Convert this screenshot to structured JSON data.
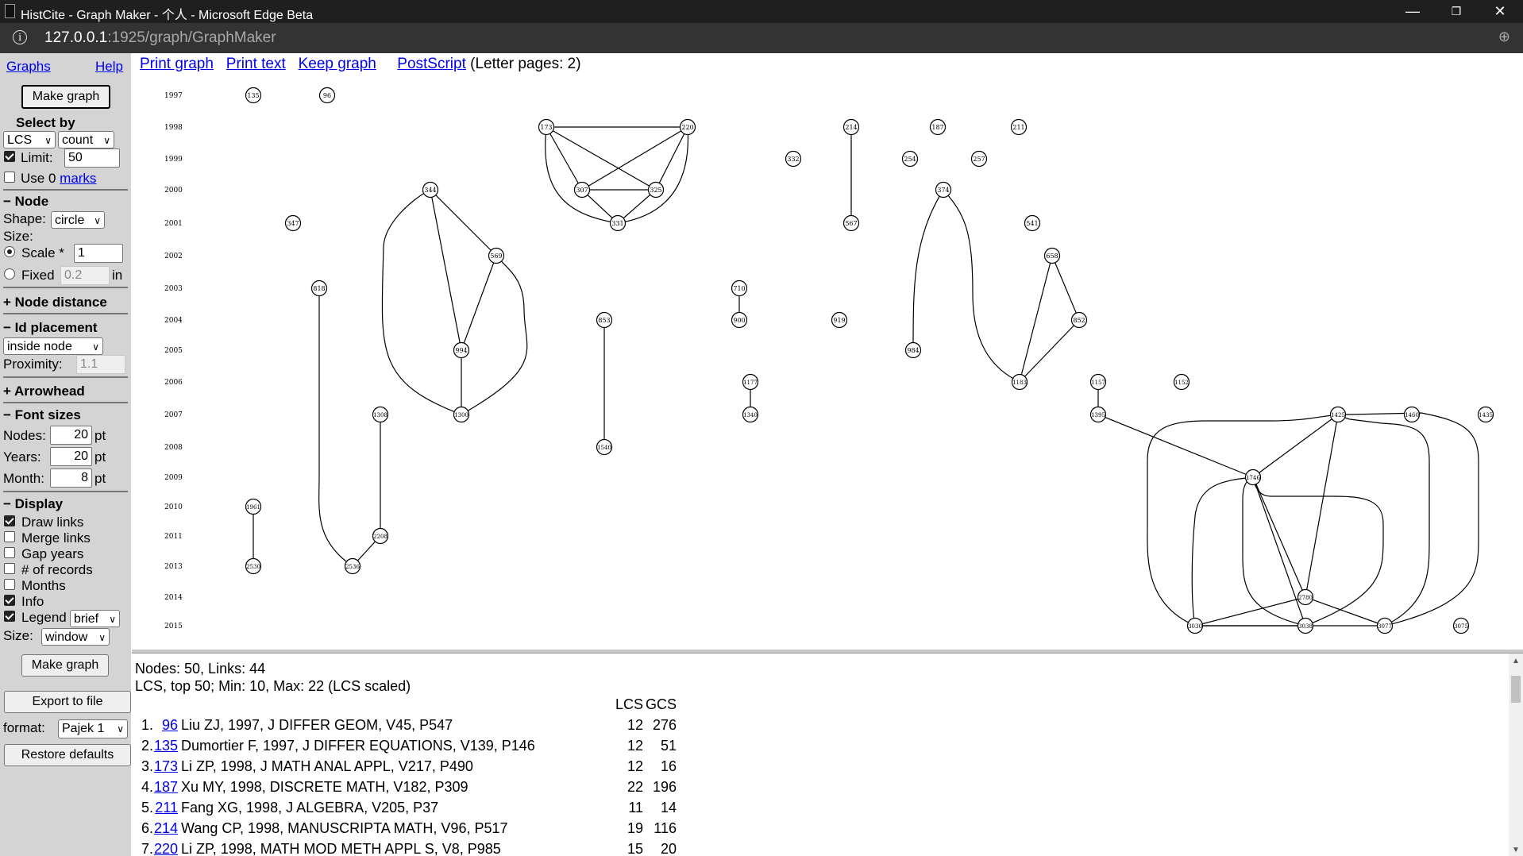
{
  "window": {
    "title": "HistCite - Graph Maker - 个人 - Microsoft Edge Beta",
    "minimize": "—",
    "maximize": "❐",
    "close": "✕"
  },
  "address": {
    "host": "127.0.0.1",
    "path": ":1925/graph/GraphMaker"
  },
  "sidebar": {
    "graphs_link": "Graphs",
    "help_link": "Help",
    "make_graph": "Make graph",
    "select_by": "Select by",
    "select_field": "LCS",
    "select_mode": "count",
    "limit_label": "Limit:",
    "limit_value": "50",
    "use_label": "Use 0",
    "marks_link": "marks",
    "node_header": "− Node",
    "shape_label": "Shape:",
    "shape_value": "circle",
    "size_label": "Size:",
    "scale_label": "Scale *",
    "scale_value": "1",
    "fixed_label": "Fixed",
    "fixed_value": "0.2",
    "fixed_unit": "in",
    "node_distance_header": "+ Node distance",
    "id_placement_header": "− Id placement",
    "id_placement_value": "inside node",
    "proximity_label": "Proximity:",
    "proximity_value": "1.1",
    "arrowhead_header": "+ Arrowhead",
    "font_sizes_header": "− Font sizes",
    "nodes_label": "Nodes:",
    "nodes_value": "20",
    "years_label": "Years:",
    "years_value": "20",
    "month_label": "Month:",
    "month_value": "8",
    "pt": "pt",
    "display_header": "− Display",
    "display_options": [
      {
        "label": "Draw links",
        "checked": true
      },
      {
        "label": "Merge links",
        "checked": false
      },
      {
        "label": "Gap years",
        "checked": false
      },
      {
        "label": "# of records",
        "checked": false
      },
      {
        "label": "Months",
        "checked": false
      },
      {
        "label": "Info",
        "checked": true
      },
      {
        "label": "Legend",
        "checked": true
      }
    ],
    "legend_value": "brief",
    "size2_label": "Size:",
    "size2_value": "window",
    "make_graph2": "Make graph",
    "export": "Export to file",
    "format_label": "format:",
    "format_value": "Pajek 1",
    "restore": "Restore defaults"
  },
  "toplinks": {
    "print_graph": "Print graph",
    "print_text": "Print text",
    "keep_graph": "Keep graph",
    "postscript": "PostScript",
    "pages": "(Letter pages: 2)"
  },
  "graph": {
    "years": [
      "1997",
      "1998",
      "1999",
      "2000",
      "2001",
      "2002",
      "2003",
      "2004",
      "2005",
      "2006",
      "2007",
      "2008",
      "2009",
      "2010",
      "2011",
      "2013",
      "2014",
      "2015"
    ],
    "nodes": [
      {
        "id": "135",
        "year": "1997"
      },
      {
        "id": "96",
        "year": "1997"
      },
      {
        "id": "173",
        "year": "1998"
      },
      {
        "id": "220",
        "year": "1998"
      },
      {
        "id": "214",
        "year": "1998"
      },
      {
        "id": "187",
        "year": "1998"
      },
      {
        "id": "211",
        "year": "1998"
      },
      {
        "id": "332",
        "year": "1999"
      },
      {
        "id": "254",
        "year": "1999"
      },
      {
        "id": "257",
        "year": "1999"
      },
      {
        "id": "344",
        "year": "2000"
      },
      {
        "id": "307",
        "year": "2000"
      },
      {
        "id": "325",
        "year": "2000"
      },
      {
        "id": "374",
        "year": "2000"
      },
      {
        "id": "347",
        "year": "2001"
      },
      {
        "id": "331",
        "year": "2001"
      },
      {
        "id": "567",
        "year": "2001"
      },
      {
        "id": "541",
        "year": "2001"
      },
      {
        "id": "569",
        "year": "2002"
      },
      {
        "id": "658",
        "year": "2002"
      },
      {
        "id": "818",
        "year": "2003"
      },
      {
        "id": "710",
        "year": "2003"
      },
      {
        "id": "853",
        "year": "2004"
      },
      {
        "id": "900",
        "year": "2004"
      },
      {
        "id": "919",
        "year": "2004"
      },
      {
        "id": "852",
        "year": "2004"
      },
      {
        "id": "994",
        "year": "2005"
      },
      {
        "id": "984",
        "year": "2005"
      },
      {
        "id": "1177",
        "year": "2006"
      },
      {
        "id": "1183",
        "year": "2006"
      },
      {
        "id": "1157",
        "year": "2006"
      },
      {
        "id": "1152",
        "year": "2006"
      },
      {
        "id": "1300",
        "year": "2007"
      },
      {
        "id": "1308",
        "year": "2007"
      },
      {
        "id": "1340",
        "year": "2007"
      },
      {
        "id": "1395",
        "year": "2007"
      },
      {
        "id": "1425",
        "year": "2007"
      },
      {
        "id": "1460",
        "year": "2007"
      },
      {
        "id": "1435",
        "year": "2007"
      },
      {
        "id": "1540",
        "year": "2008"
      },
      {
        "id": "1746",
        "year": "2009"
      },
      {
        "id": "1961",
        "year": "2010"
      },
      {
        "id": "2208",
        "year": "2011"
      },
      {
        "id": "2530",
        "year": "2013"
      },
      {
        "id": "2536",
        "year": "2013"
      },
      {
        "id": "2780",
        "year": "2014"
      },
      {
        "id": "3030",
        "year": "2015"
      },
      {
        "id": "3038",
        "year": "2015"
      },
      {
        "id": "3077",
        "year": "2015"
      },
      {
        "id": "3075",
        "year": "2015"
      }
    ]
  },
  "info": {
    "summary1": "Nodes: 50, Links: 44",
    "summary2": "LCS, top 50; Min: 10, Max: 22 (LCS scaled)",
    "col_lcs": "LCS",
    "col_gcs": "GCS",
    "records": [
      {
        "num": "1.",
        "id": "96",
        "text": "Liu ZJ, 1997, J DIFFER GEOM, V45, P547",
        "lcs": "12",
        "gcs": "276"
      },
      {
        "num": "2.",
        "id": "135",
        "text": "Dumortier F, 1997, J DIFFER EQUATIONS, V139, P146",
        "lcs": "12",
        "gcs": "51"
      },
      {
        "num": "3.",
        "id": "173",
        "text": "Li ZP, 1998, J MATH ANAL APPL, V217, P490",
        "lcs": "12",
        "gcs": "16"
      },
      {
        "num": "4.",
        "id": "187",
        "text": "Xu MY, 1998, DISCRETE MATH, V182, P309",
        "lcs": "22",
        "gcs": "196"
      },
      {
        "num": "5.",
        "id": "211",
        "text": "Fang XG, 1998, J ALGEBRA, V205, P37",
        "lcs": "11",
        "gcs": "14"
      },
      {
        "num": "6.",
        "id": "214",
        "text": "Wang CP, 1998, MANUSCRIPTA MATH, V96, P517",
        "lcs": "19",
        "gcs": "116"
      },
      {
        "num": "7.",
        "id": "220",
        "text": "Li ZP, 1998, MATH MOD METH APPL S, V8, P985",
        "lcs": "15",
        "gcs": "20"
      }
    ]
  }
}
